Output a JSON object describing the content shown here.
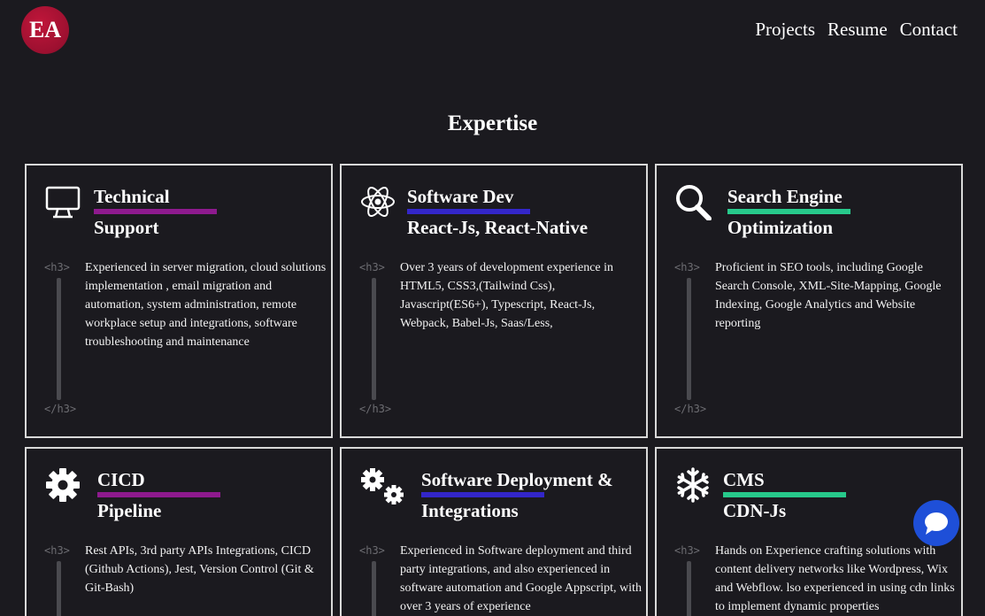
{
  "header": {
    "logo_text": "EA",
    "nav": [
      "Projects",
      "Resume",
      "Contact"
    ]
  },
  "section_title": "Expertise",
  "colors": {
    "purple": "#8e1a8e",
    "blue": "#3326c9",
    "green": "#27c98b",
    "chat": "#1e4fd8"
  },
  "cards": [
    {
      "icon": "monitor-icon",
      "title": "Technical",
      "subtitle": "Support",
      "tag_open": "<h3>",
      "tag_close": "</h3>",
      "description": "Experienced in server migration, cloud solutions implementation , email migration and automation, system administration, remote workplace setup and integrations, software troubleshooting and maintenance"
    },
    {
      "icon": "atom-icon",
      "title": "Software Dev",
      "subtitle": "React-Js, React-Native",
      "tag_open": "<h3>",
      "tag_close": "</h3>",
      "description": "Over 3 years of development experience in HTML5, CSS3,(Tailwind Css), Javascript(ES6+), Typescript, React-Js, Webpack, Babel-Js, Saas/Less,"
    },
    {
      "icon": "search-icon",
      "title": "Search Engine",
      "subtitle": "Optimization",
      "tag_open": "<h3>",
      "tag_close": "</h3>",
      "description": "Proficient in SEO tools, including Google Search Console, XML-Site-Mapping, Google Indexing, Google Analytics and Website reporting"
    },
    {
      "icon": "gear-icon",
      "title": "CICD",
      "subtitle": "Pipeline",
      "tag_open": "<h3>",
      "description": "Rest APIs, 3rd party APIs Integrations, CICD (Github Actions), Jest, Version Control (Git & Git-Bash)"
    },
    {
      "icon": "gears-icon",
      "title": "Software Deployment &",
      "subtitle": "Integrations",
      "tag_open": "<h3>",
      "description": "Experienced in Software deployment and third party integrations, and also experienced in software automation and Google Appscript, with over 3 years of experience"
    },
    {
      "icon": "snowflake-icon",
      "title": "CMS",
      "subtitle": "CDN-Js",
      "tag_open": "<h3>",
      "description": "Hands on Experience crafting solutions with content delivery networks like Wordpress, Wix and Webflow. lso experienced in using cdn links to implement dynamic properties"
    }
  ],
  "chat_button": {
    "icon": "chat-icon"
  }
}
